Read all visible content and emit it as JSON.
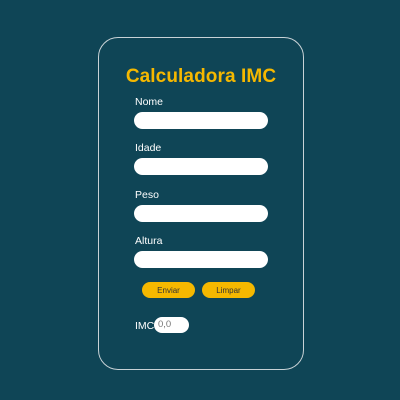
{
  "form": {
    "title": "Calculadora IMC",
    "fields": [
      {
        "label": "Nome",
        "value": "",
        "placeholder": ""
      },
      {
        "label": "Idade",
        "value": "",
        "placeholder": ""
      },
      {
        "label": "Peso",
        "value": "",
        "placeholder": ""
      },
      {
        "label": "Altura",
        "value": "",
        "placeholder": ""
      }
    ],
    "submit_label": "Enviar",
    "clear_label": "Limpar",
    "result_label": "IMC",
    "result_value": "0,0"
  },
  "colors": {
    "background": "#0f4556",
    "accent": "#f5b800",
    "card_border": "#c8d2d6",
    "text": "#ffffff"
  }
}
